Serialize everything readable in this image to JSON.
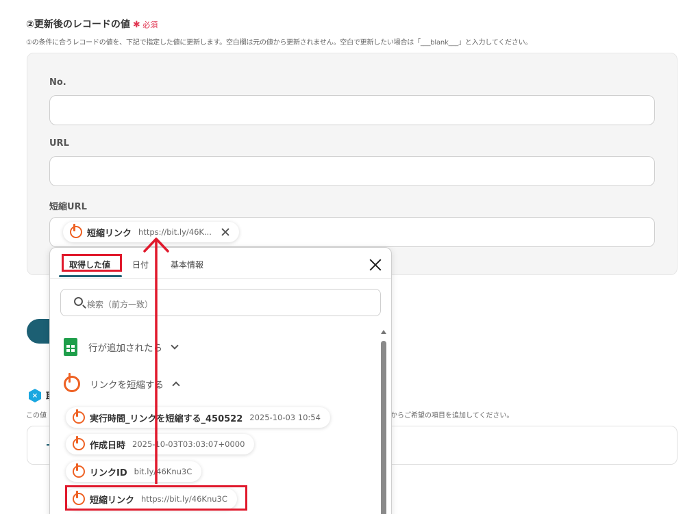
{
  "section": {
    "title": "②更新後のレコードの値",
    "required_star": "✱",
    "required_label": "必須",
    "description": "①の条件に合うレコードの値を、下記で指定した値に更新します。空白欄は元の値から更新されません。空白で更新したい場合は「___blank___」と入力してください。"
  },
  "fields": [
    {
      "label": "No.",
      "value": ""
    },
    {
      "label": "URL",
      "value": ""
    },
    {
      "label": "短縮URL"
    }
  ],
  "short_url_chip": {
    "label": "短縮リンク",
    "value": "https://bit.ly/46K..."
  },
  "dropdown": {
    "tabs": [
      "取得した値",
      "日付",
      "基本情報"
    ],
    "active_tab": "取得した値",
    "search_placeholder": "検索（前方一致）",
    "groups": [
      {
        "label": "行が追加されたら",
        "expanded": false
      },
      {
        "label": "リンクを短縮する",
        "expanded": true
      }
    ],
    "items": [
      {
        "label": "実行時間_リンクを短縮する_450522",
        "value": "2025-10-03 10:54"
      },
      {
        "label": "作成日時",
        "value": "2025-10-03T03:03:07+0000"
      },
      {
        "label": "リンクID",
        "value": "bit.ly/46Knu3C"
      },
      {
        "label": "短縮リンク",
        "value": "https://bit.ly/46Knu3C"
      }
    ]
  },
  "background": {
    "next_section_icon": "×",
    "next_section_title": "取",
    "next_desc_left": "この値",
    "next_desc_right": "からご希望の項目を追加してください。"
  },
  "colors": {
    "accent": "#1c5f73",
    "required": "#e0334f",
    "highlight": "#e0192c",
    "bitly": "#ee6123"
  }
}
